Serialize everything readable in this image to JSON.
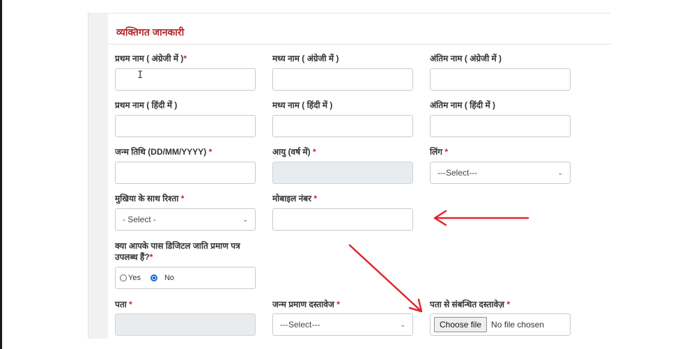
{
  "section": {
    "title": "व्यक्तिगत जानकारी"
  },
  "fields": {
    "first_name_en": {
      "label": "प्रथम नाम ( अंग्रेजी में )",
      "required": "*",
      "value": ""
    },
    "middle_name_en": {
      "label": "मध्य नाम ( अंग्रेजी में )",
      "value": ""
    },
    "last_name_en": {
      "label": "अंतिम नाम ( अंग्रेजी में )",
      "value": ""
    },
    "first_name_hi": {
      "label": "प्रथम नाम ( हिंदी में )",
      "value": ""
    },
    "middle_name_hi": {
      "label": "मध्य नाम ( हिंदी में )",
      "value": ""
    },
    "last_name_hi": {
      "label": "अंतिम नाम ( हिंदी में )",
      "value": ""
    },
    "dob": {
      "label": "जन्म तिथि (DD/MM/YYYY)",
      "required": "*",
      "value": ""
    },
    "age": {
      "label": "आयु (वर्ष में)",
      "required": "*",
      "value": ""
    },
    "gender": {
      "label": "लिंग",
      "required": "*",
      "selected": "---Select---"
    },
    "relation": {
      "label": "मुखिया के साथ रिश्ता",
      "required": "*",
      "selected": "- Select -"
    },
    "mobile": {
      "label": "मोबाइल नंबर",
      "required": "*",
      "value": ""
    },
    "digital_caste": {
      "label": "क्या आपके पास डिजिटल जाति प्रमाण पत्र उपलब्ध हैं?",
      "required": "*",
      "options": [
        "Yes",
        "No"
      ],
      "selected": "No"
    },
    "address": {
      "label": "पता",
      "required": "*",
      "value": ""
    },
    "birth_doc": {
      "label": "जन्म प्रमाण दस्तावेज",
      "required": "*",
      "selected": "---Select---"
    },
    "address_doc": {
      "label": "पता से संबन्धित दस्तावेज़",
      "required": "*",
      "button": "Choose file",
      "status": "No file chosen"
    }
  },
  "colors": {
    "section_title": "#b4262a",
    "required_mark": "#d11a1a",
    "annotation_arrow": "#e0262b",
    "radio_accent": "#1967d2"
  }
}
